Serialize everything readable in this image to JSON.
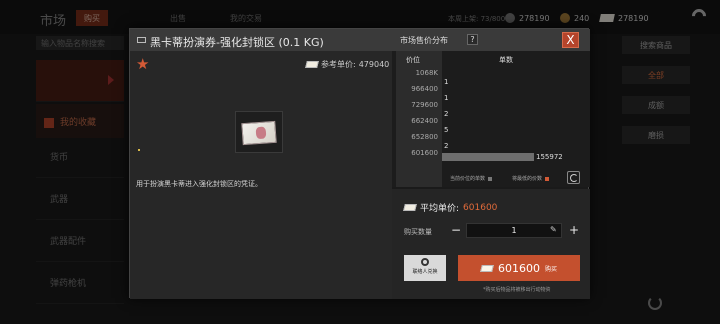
{
  "background": {
    "title": "市场",
    "tabs": [
      "购买",
      "出售",
      "我的交易"
    ],
    "ratio": "本周上架: 73/800",
    "currency_bills": "278190",
    "currency_gold": "240",
    "currency_wallet": "278190",
    "search_placeholder": "输入物品名称搜索",
    "sidebar": [
      "我的收藏",
      "货币",
      "武器",
      "武器配件",
      "弹药枪机"
    ],
    "right_buttons": [
      "搜索商品",
      "全部",
      "成额",
      "磨损"
    ]
  },
  "modal": {
    "title": "黑卡蒂扮演券-强化封锁区 (0.1 KG)",
    "market_title": "市场售价分布",
    "help": "?",
    "close": "X",
    "ref_price_label": "参考单价:",
    "ref_price_value": "479040",
    "description": "用于扮演黑卡蒂进入强化封锁区的凭证。",
    "distribution": {
      "price_header": "价位",
      "qty_header": "单数",
      "rows": [
        {
          "price": "1068K",
          "qty": ""
        },
        {
          "price": "966400",
          "qty": "1"
        },
        {
          "price": "729600",
          "qty": "1"
        },
        {
          "price": "662400",
          "qty": "2"
        },
        {
          "price": "652800",
          "qty": "5"
        },
        {
          "price": "601600",
          "qty": "2"
        },
        {
          "price": "",
          "qty": "155972"
        }
      ],
      "legend_current": "当前价位的单数",
      "legend_lowest": "将最低的价数",
      "colors": {
        "bar": "#6e6e6e",
        "accent": "#d35a36"
      }
    },
    "purchase": {
      "avg_label": "平均单价:",
      "avg_value": "601600",
      "qty_label": "购买数量",
      "minus": "−",
      "qty_value": "1",
      "plus": "+",
      "exchange_label": "联络人兑换",
      "buy_price": "601600",
      "buy_label": "购买",
      "note": "*购买后物品将被移出行动物资"
    }
  }
}
